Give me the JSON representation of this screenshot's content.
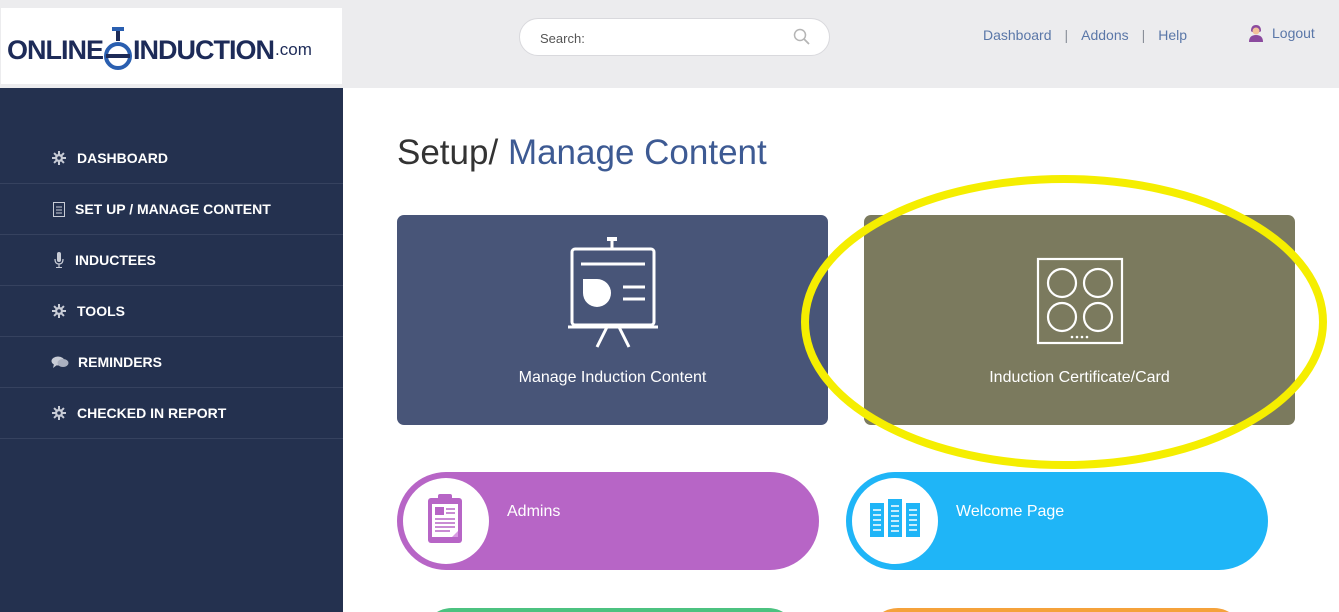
{
  "header": {
    "logo": {
      "word1": "ONLINE",
      "word2": "INDUCTION",
      "domain": ".com"
    },
    "search": {
      "placeholder": "Search:",
      "value": ""
    },
    "links": [
      "Dashboard",
      "Addons",
      "Help"
    ],
    "separator": "|",
    "logout_label": "Logout"
  },
  "sidebar": {
    "items": [
      {
        "label": "DASHBOARD",
        "icon": "gear-icon"
      },
      {
        "label": "SET UP / MANAGE CONTENT",
        "icon": "document-icon"
      },
      {
        "label": "INDUCTEES",
        "icon": "microphone-icon"
      },
      {
        "label": "TOOLS",
        "icon": "gear-icon"
      },
      {
        "label": "REMINDERS",
        "icon": "chat-icon"
      },
      {
        "label": "CHECKED IN REPORT",
        "icon": "gear-icon"
      }
    ]
  },
  "main": {
    "title": {
      "prefix": "Setup/",
      "accent": "Manage Content"
    },
    "cards": [
      {
        "label": "Manage Induction Content",
        "icon": "presentation-board-icon",
        "color": "#485578"
      },
      {
        "label": "Induction Certificate/Card",
        "icon": "cooktop-icon",
        "color": "#7b7a5e"
      }
    ],
    "pills": [
      {
        "label": "Admins",
        "icon": "clipboard-icon",
        "color": "#b765c6"
      },
      {
        "label": "Welcome Page",
        "icon": "server-racks-icon",
        "color": "#1fb5f7"
      }
    ]
  },
  "colors": {
    "sidebar_bg": "#24314f",
    "topbar_bg": "#ececee",
    "accent_text": "#3d5a93",
    "highlight": "#f5ee00",
    "peek_green": "#4cc280",
    "peek_orange": "#f5a23b"
  }
}
